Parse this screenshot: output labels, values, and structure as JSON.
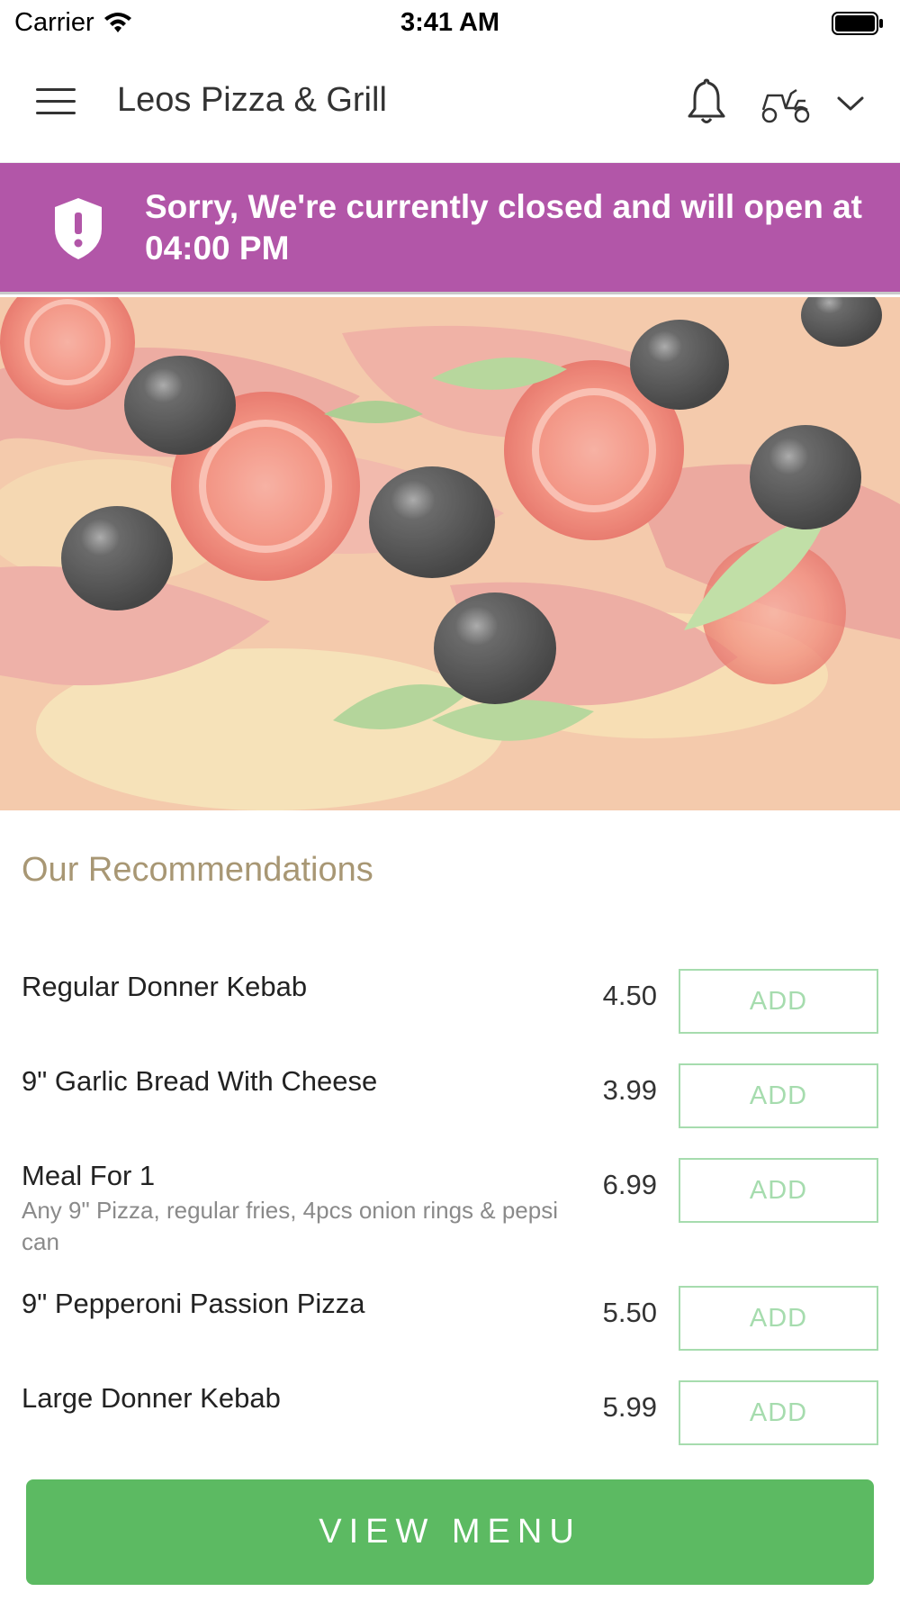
{
  "status_bar": {
    "carrier": "Carrier",
    "time": "3:41 AM"
  },
  "header": {
    "title": "Leos Pizza & Grill",
    "icons": [
      "hamburger-menu-icon",
      "bell-icon",
      "delivery-scooter-icon",
      "chevron-down-icon"
    ]
  },
  "banner": {
    "message": "Sorry, We're currently closed and will open at 04:00 PM",
    "color": "#b256a8",
    "icon": "shield-alert-icon"
  },
  "recommendations": {
    "title": "Our Recommendations",
    "items": [
      {
        "name": "Regular Donner Kebab",
        "description": "",
        "price": "4.50",
        "button": "ADD"
      },
      {
        "name": "9\" Garlic Bread With Cheese",
        "description": "",
        "price": "3.99",
        "button": "ADD"
      },
      {
        "name": "Meal For 1",
        "description": "Any 9\" Pizza, regular fries, 4pcs onion rings & pepsi can",
        "price": "6.99",
        "button": "ADD"
      },
      {
        "name": "9\" Pepperoni Passion Pizza",
        "description": "",
        "price": "5.50",
        "button": "ADD"
      },
      {
        "name": "Large Donner Kebab",
        "description": "",
        "price": "5.99",
        "button": "ADD"
      }
    ]
  },
  "footer": {
    "view_menu_label": "VIEW MENU",
    "color": "#5cba62"
  }
}
